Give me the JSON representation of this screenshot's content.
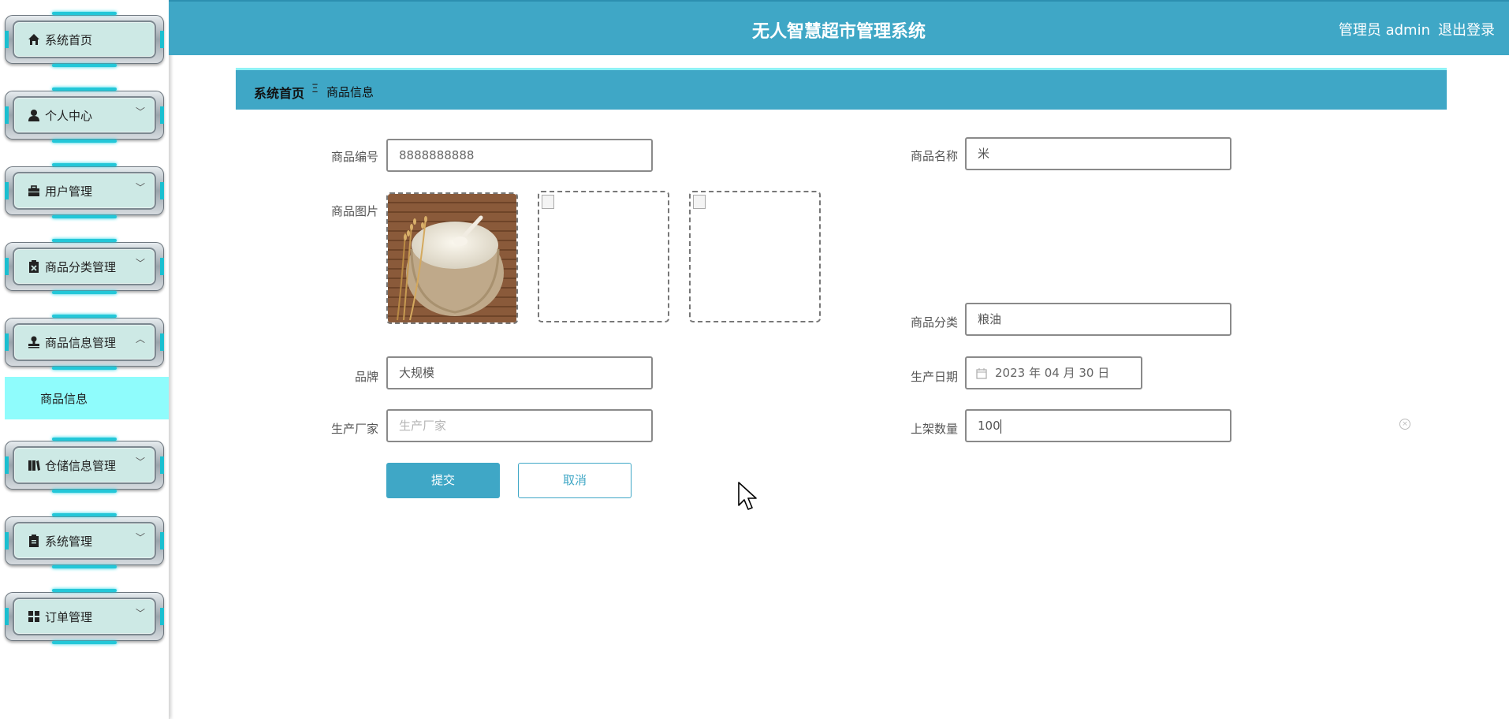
{
  "app": {
    "title": "无人智慧超市管理系统",
    "user_label": "管理员 admin",
    "logout_label": "退出登录"
  },
  "sidebar": {
    "items": [
      {
        "label": "系统首页",
        "icon": "home-icon",
        "has_chevron": false
      },
      {
        "label": "个人中心",
        "icon": "person-icon",
        "has_chevron": true
      },
      {
        "label": "用户管理",
        "icon": "briefcase-icon",
        "has_chevron": true
      },
      {
        "label": "商品分类管理",
        "icon": "clipboard-x-icon",
        "has_chevron": true
      },
      {
        "label": "商品信息管理",
        "icon": "stamp-icon",
        "has_chevron": true,
        "expanded": true
      },
      {
        "label": "仓储信息管理",
        "icon": "books-icon",
        "has_chevron": true
      },
      {
        "label": "系统管理",
        "icon": "clipboard-icon",
        "has_chevron": true
      },
      {
        "label": "订单管理",
        "icon": "grid-icon",
        "has_chevron": true
      }
    ],
    "active_submenu": "商品信息",
    "chevron_down": "﹀",
    "chevron_up": "︿"
  },
  "breadcrumb": {
    "home": "系统首页",
    "separator": "Ξ",
    "current": "商品信息"
  },
  "form": {
    "product_code": {
      "label": "商品编号",
      "value": "8888888888"
    },
    "product_name": {
      "label": "商品名称",
      "value": "米"
    },
    "product_image": {
      "label": "商品图片"
    },
    "category": {
      "label": "商品分类",
      "value": "粮油"
    },
    "brand": {
      "label": "品牌",
      "value": "大规模"
    },
    "production_date": {
      "label": "生产日期",
      "value": "2023 年 04 月 30 日"
    },
    "manufacturer": {
      "label": "生产厂家",
      "placeholder": "生产厂家"
    },
    "shelf_quantity": {
      "label": "上架数量",
      "value": "100"
    },
    "submit_label": "提交",
    "cancel_label": "取消"
  },
  "colors": {
    "primary": "#3fa7c6",
    "active_submenu": "#8ffcfc",
    "menu_glow": "#23c7d8"
  }
}
